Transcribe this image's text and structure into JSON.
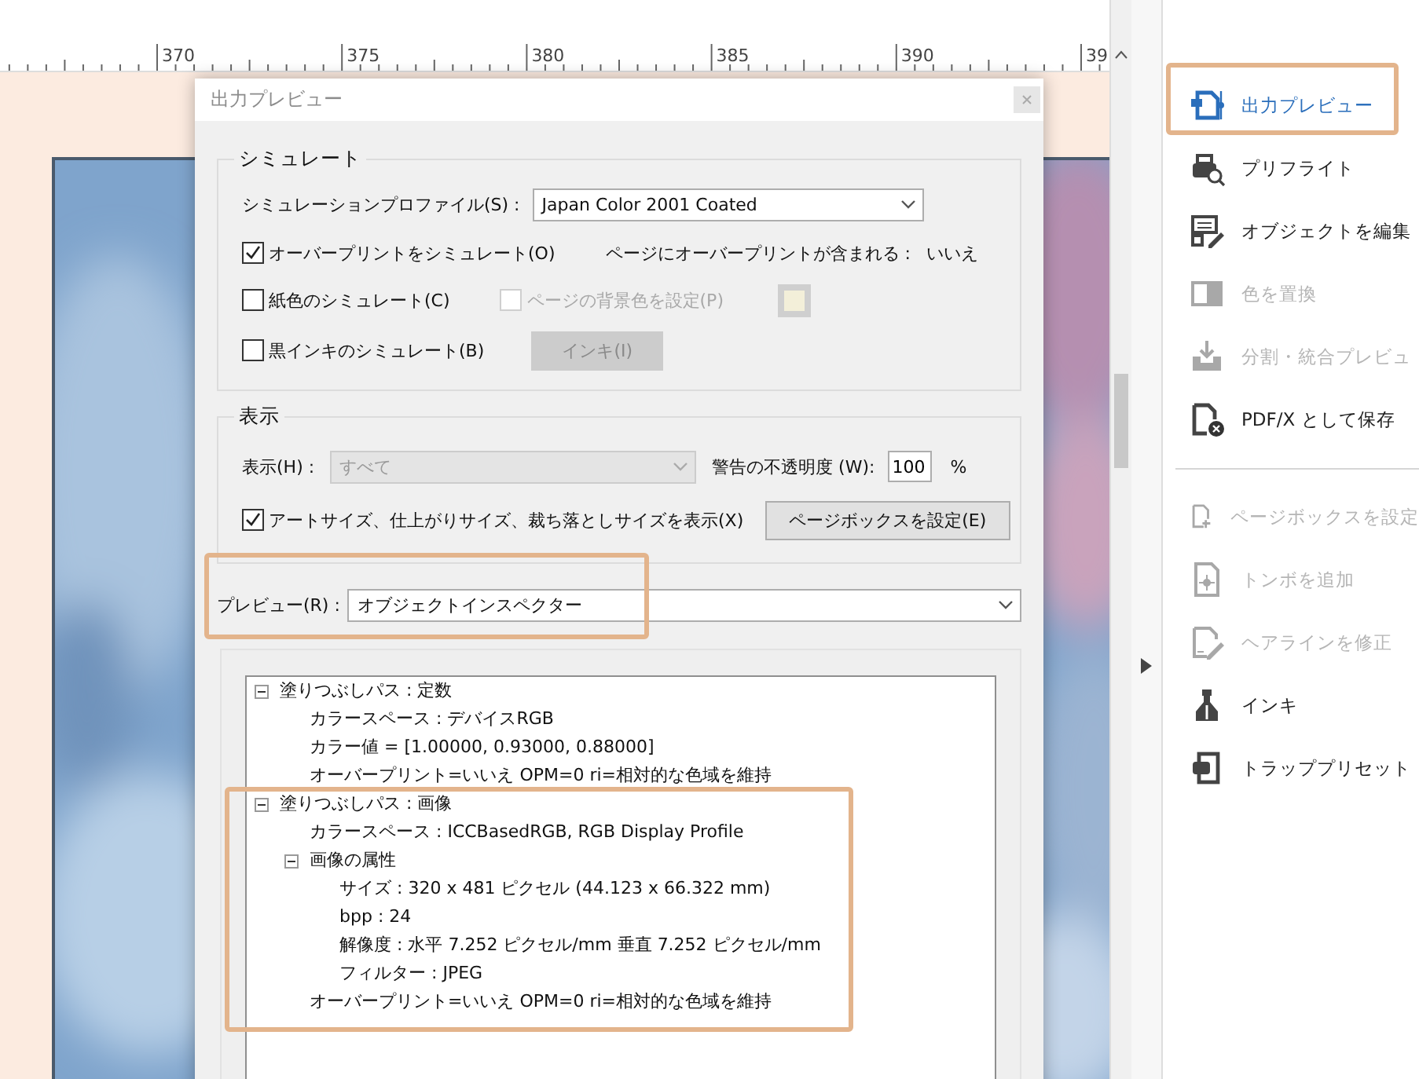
{
  "ruler": {
    "labels": [
      "370",
      "375",
      "380",
      "385",
      "390",
      "39"
    ]
  },
  "dialog": {
    "title": "出力プレビュー",
    "simulate": {
      "legend": "シミュレート",
      "profile_label": "シミュレーションプロファイル(S) :",
      "profile_value": "Japan Color 2001 Coated",
      "overprint": {
        "label": "オーバープリントをシミュレート(O)",
        "checked": true
      },
      "overprint_info": {
        "label": "ページにオーバープリントが含まれる :",
        "value": "いいえ"
      },
      "paper_color": {
        "label": "紙色のシミュレート(C)",
        "checked": false
      },
      "page_background": {
        "label": "ページの背景色を設定(P)",
        "checked": false,
        "disabled": true
      },
      "black_ink": {
        "label": "黒インキのシミュレート(B)",
        "checked": false
      },
      "ink_button": {
        "label": "インキ(I)",
        "disabled": true
      }
    },
    "display": {
      "legend": "表示",
      "show_label": "表示(H) :",
      "show_value": "すべて",
      "show_disabled": true,
      "opacity_label": "警告の不透明度 (W):",
      "opacity_value": "100",
      "opacity_unit": "%",
      "boxes": {
        "label": "アートサイズ、仕上がりサイズ、裁ち落としサイズを表示(X)",
        "checked": true
      },
      "page_box_button": "ページボックスを設定(E)"
    },
    "preview": {
      "label": "プレビュー(R) :",
      "value": "オブジェクトインスペクター"
    },
    "tree": [
      {
        "text": "塗りつぶしパス : 定数",
        "expanded": true,
        "children": [
          {
            "text": "カラースペース : デバイスRGB"
          },
          {
            "text": "カラー値 = [1.00000, 0.93000, 0.88000]"
          },
          {
            "text": "オーバープリント=いいえ OPM=0 ri=相対的な色域を維持"
          }
        ]
      },
      {
        "text": "塗りつぶしパス : 画像",
        "expanded": true,
        "children": [
          {
            "text": "カラースペース : ICCBasedRGB, RGB Display Profile"
          },
          {
            "text": "画像の属性",
            "expanded": true,
            "children": [
              {
                "text": "サイズ : 320 x 481 ピクセル (44.123 x 66.322 mm)"
              },
              {
                "text": "bpp : 24"
              },
              {
                "text": "解像度 : 水平 7.252 ピクセル/mm 垂直 7.252 ピクセル/mm"
              },
              {
                "text": "フィルター : JPEG"
              }
            ]
          },
          {
            "text": "オーバープリント=いいえ OPM=0 ri=相対的な色域を維持"
          }
        ]
      }
    ]
  },
  "tools": [
    {
      "items": [
        {
          "label": "出力プレビュー",
          "selected": true,
          "disabled": false
        },
        {
          "label": "プリフライト",
          "selected": false,
          "disabled": false
        },
        {
          "label": "オブジェクトを編集",
          "selected": false,
          "disabled": false
        },
        {
          "label": "色を置換",
          "selected": false,
          "disabled": true
        },
        {
          "label": "分割・統合プレビュ",
          "selected": false,
          "disabled": true
        },
        {
          "label": "PDF/X として保存",
          "selected": false,
          "disabled": false
        }
      ]
    },
    {
      "items": [
        {
          "label": "ページボックスを設定",
          "selected": false,
          "disabled": true
        },
        {
          "label": "トンボを追加",
          "selected": false,
          "disabled": true
        },
        {
          "label": "ヘアラインを修正",
          "selected": false,
          "disabled": true
        },
        {
          "label": "インキ",
          "selected": false,
          "disabled": false
        },
        {
          "label": "トラッププリセット",
          "selected": false,
          "disabled": false
        }
      ]
    }
  ]
}
